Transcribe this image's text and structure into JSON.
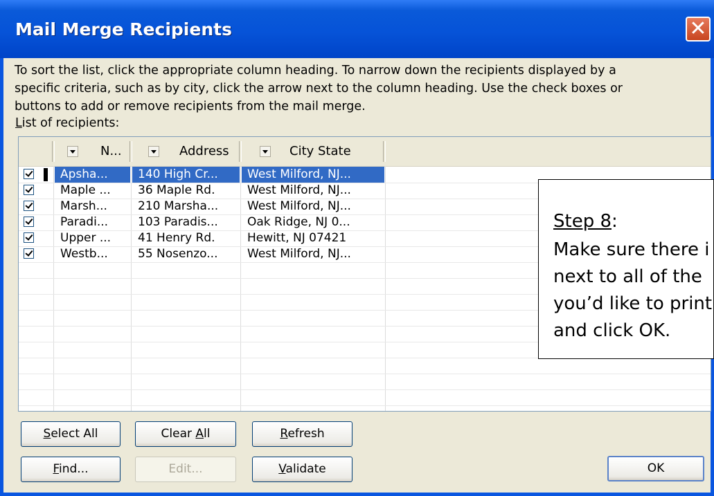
{
  "window": {
    "title": "Mail Merge Recipients",
    "close_glyph": "✕"
  },
  "instructions": {
    "line1": "To sort the list, click the appropriate column heading.  To narrow down the recipients displayed by a",
    "line2": "specific criteria, such as by city, click the arrow next to the column heading.  Use the check boxes or",
    "line3": "buttons to add or remove recipients from the mail merge."
  },
  "list_label": {
    "accel": "L",
    "rest": "ist of recipients:"
  },
  "columns": [
    {
      "label": "N..."
    },
    {
      "label": "Address"
    },
    {
      "label": "City State"
    }
  ],
  "rows": [
    {
      "checked": true,
      "selected": true,
      "name": "Apsha...",
      "address": "140 High Cr...",
      "city": "West Milford, NJ..."
    },
    {
      "checked": true,
      "selected": false,
      "name": "Maple ...",
      "address": "36 Maple Rd.",
      "city": "West Milford, NJ..."
    },
    {
      "checked": true,
      "selected": false,
      "name": "Marsh...",
      "address": "210 Marsha...",
      "city": "West Milford, NJ..."
    },
    {
      "checked": true,
      "selected": false,
      "name": "Paradi...",
      "address": "103 Paradis...",
      "city": "Oak Ridge, NJ 0..."
    },
    {
      "checked": true,
      "selected": false,
      "name": "Upper ...",
      "address": "41 Henry Rd.",
      "city": "Hewitt, NJ 07421"
    },
    {
      "checked": true,
      "selected": false,
      "name": "Westb...",
      "address": "55 Nosenzo...",
      "city": "West Milford, NJ..."
    }
  ],
  "callout": {
    "heading": "Step 8",
    "colon": ":",
    "line1": "Make sure there i",
    "line2": "next to all of the",
    "line3": "you’d like to print",
    "line4": "and click OK."
  },
  "buttons": {
    "select_all": {
      "accel": "S",
      "rest": "elect All"
    },
    "clear_all": {
      "pre": "Clear ",
      "accel": "A",
      "rest": "ll"
    },
    "refresh": {
      "accel": "R",
      "rest": "efresh"
    },
    "find": {
      "accel": "F",
      "rest": "ind..."
    },
    "edit": {
      "label": "Edit..."
    },
    "validate": {
      "accel": "V",
      "rest": "alidate"
    },
    "ok": {
      "label": "OK"
    }
  },
  "colors": {
    "titlebar": "#0653d8",
    "dialog_bg": "#ece9d8",
    "selection": "#316ac5",
    "close_button": "#c8451f"
  }
}
